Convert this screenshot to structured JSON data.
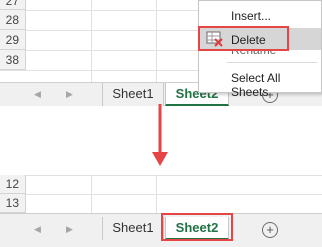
{
  "top_sheet": {
    "row_numbers": [
      "27",
      "28",
      "29",
      "38"
    ],
    "tabs": [
      "Sheet1",
      "Sheet2"
    ],
    "active_tab": "Sheet2"
  },
  "context_menu": {
    "items": [
      "Insert...",
      "Delete",
      "Rename",
      "Select All Sheets"
    ],
    "highlighted": "Delete"
  },
  "bottom_sheet": {
    "row_numbers": [
      "12",
      "13"
    ],
    "tabs": [
      "Sheet1",
      "Sheet2"
    ],
    "active_tab": "Sheet2"
  },
  "icons": {
    "nav_prev": "triangle-left",
    "nav_next": "triangle-right",
    "add_sheet": "circle-plus",
    "delete_sheet": "sheet-with-red-x",
    "transition_arrow": "red-down-arrow"
  },
  "colors": {
    "highlight": "#e64545",
    "active_tab_text": "#217346",
    "menu_hover": "#d6d6d6"
  }
}
